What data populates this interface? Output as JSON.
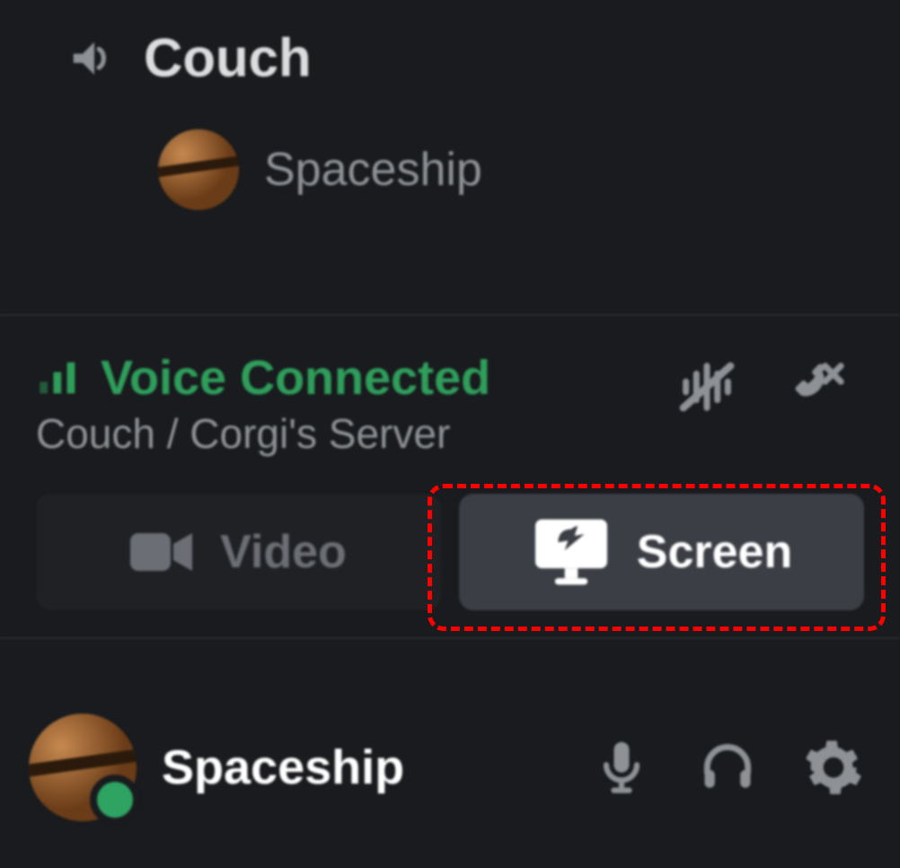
{
  "channel": {
    "name": "Couch",
    "member": "Spaceship"
  },
  "voice": {
    "status_title": "Voice Connected",
    "status_sub": "Couch / Corgi's Server",
    "video_btn": "Video",
    "screen_btn": "Screen"
  },
  "user": {
    "name": "Spaceship"
  },
  "colors": {
    "accent_green": "#2f9e5b",
    "highlight_red": "#ff0000"
  },
  "highlight": {
    "target": "screen-share-button"
  }
}
